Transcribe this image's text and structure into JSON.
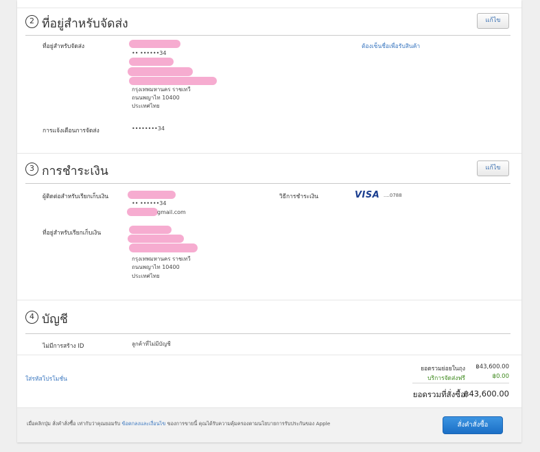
{
  "shipping": {
    "step": "2",
    "title": "ที่อยู่สำหรับจัดส่ง",
    "edit_label": "แก้ไข",
    "address_label": "ที่อยู่สำหรับจัดส่ง",
    "phone_masked": "•• ••••••34",
    "address_lines": [
      "กรุงเทพมหานคร ราชเทวี",
      "ถนนพญาไท 10400",
      "ประเทศไทย"
    ],
    "signature_link": "ต้องเซ็นชื่อเพื่อรับสินค้า",
    "notify_label": "การแจ้งเตือนการจัดส่ง",
    "notify_value": "••••••••34"
  },
  "payment": {
    "step": "3",
    "title": "การชำระเงิน",
    "edit_label": "แก้ไข",
    "billing_contact_label": "ผู้ติดต่อสำหรับเรียกเก็บเงิน",
    "phone_masked": "•• ••••••34",
    "email_suffix": "gmail.com",
    "method_label": "วิธีการชำระเงิน",
    "card_brand": "VISA",
    "card_mask": "....0788",
    "billing_address_label": "ที่อยู่สำหรับเรียกเก็บเงิน",
    "address_lines": [
      "กรุงเทพมหานคร ราชเทวี",
      "ถนนพญาไท 10400",
      "ประเทศไทย"
    ]
  },
  "account": {
    "step": "4",
    "title": "บัญชี",
    "label": "ไม่มีการสร้าง ID",
    "value": "ลูกค้าที่ไม่มีบัญชี"
  },
  "summary": {
    "promo_link": "ใส่รหัสโปรโมชั่น",
    "subtotal_label": "ยอดรวมย่อยในถุง",
    "subtotal_value": "฿43,600.00",
    "shipping_label": "บริการจัดส่งฟรี",
    "shipping_value": "฿0.00",
    "total_label": "ยอดรวมที่สั่งซื้อ",
    "total_value": "฿43,600.00"
  },
  "footer": {
    "text_before": "เมื่อคลิกปุ่ม สั่งคำสั่งซื้อ เท่ากับว่าคุณยอมรับ ",
    "terms_link": "ข้อตกลงและเงื่อนไข",
    "text_after": " ของการขายนี้ คุณได้รับความคุ้มครองตามนโยบายการรับประกันของ Apple",
    "place_order_label": "สั่งคำสั่งซื้อ"
  },
  "colors": {
    "accent": "#1b6fc6",
    "link": "#3c78c0",
    "free_shipping": "#3f8a1f",
    "redaction": "#f6a8cd"
  }
}
